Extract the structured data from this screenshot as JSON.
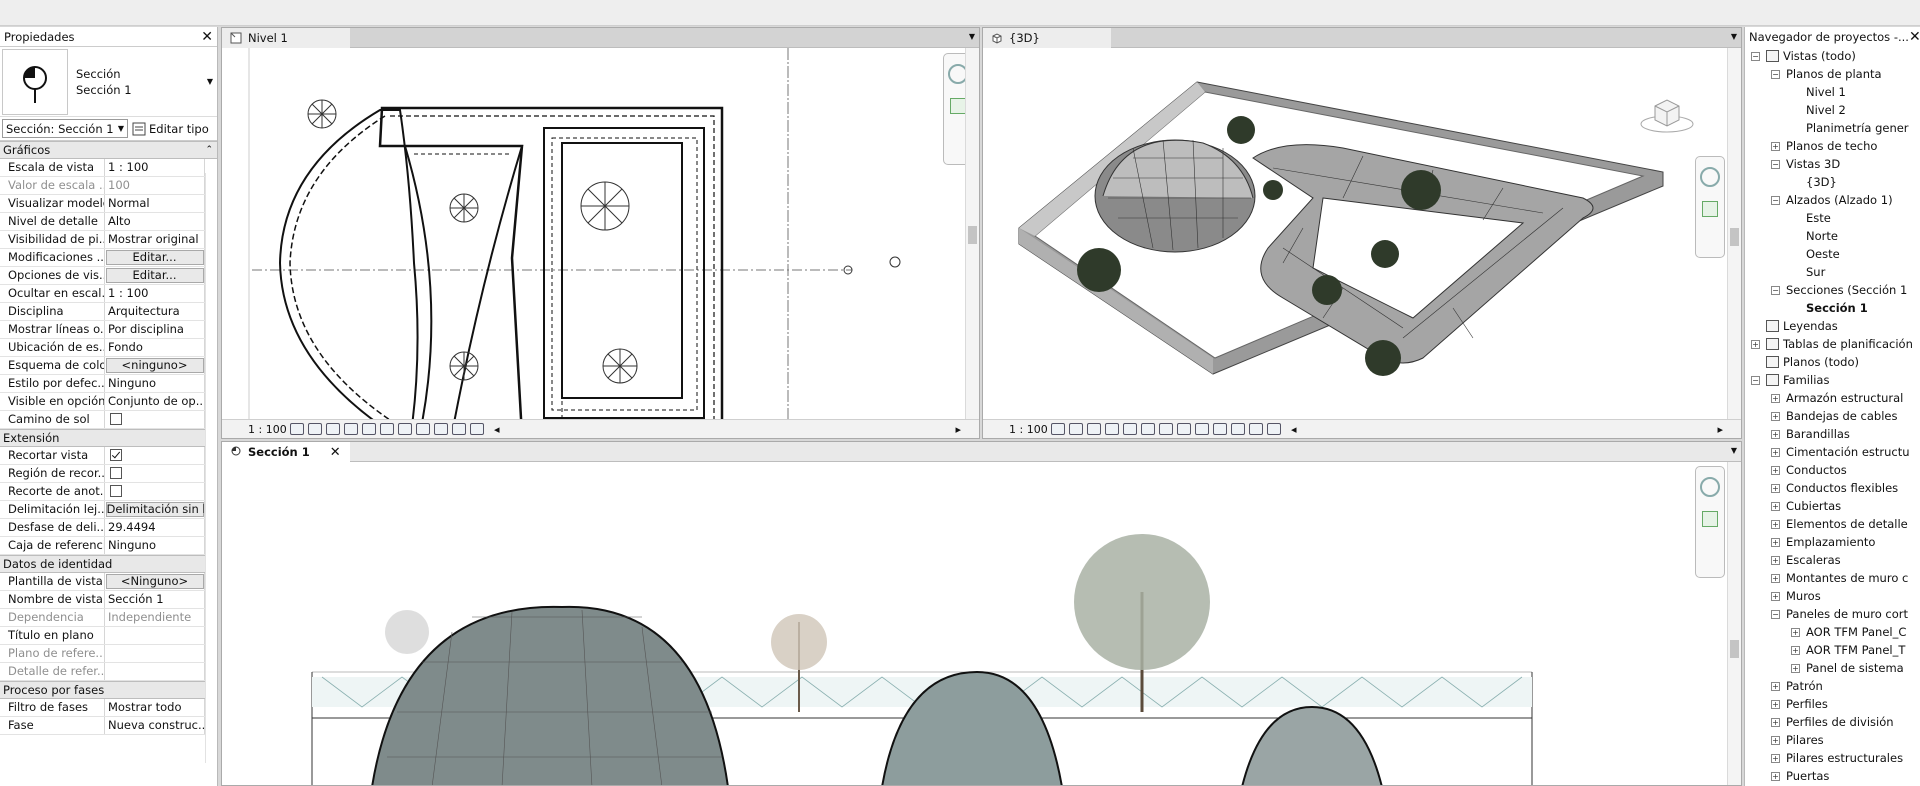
{
  "properties": {
    "title": "Propiedades",
    "close": "✕",
    "type_name": "Sección",
    "type_sub": "Sección 1",
    "selector": "Sección: Sección 1",
    "edit_type": "Editar tipo",
    "groups": [
      {
        "label": "Gráficos",
        "rows": [
          {
            "k": "Escala de vista",
            "v": "1 : 100"
          },
          {
            "k": "Valor de escala ...",
            "v": "100",
            "dim": true
          },
          {
            "k": "Visualizar modelo",
            "v": "Normal"
          },
          {
            "k": "Nivel de detalle",
            "v": "Alto"
          },
          {
            "k": "Visibilidad de pi...",
            "v": "Mostrar original"
          },
          {
            "k": "Modificaciones ...",
            "btn": "Editar..."
          },
          {
            "k": "Opciones de vis...",
            "btn": "Editar..."
          },
          {
            "k": "Ocultar en escal...",
            "v": "1 : 100"
          },
          {
            "k": "Disciplina",
            "v": "Arquitectura"
          },
          {
            "k": "Mostrar líneas o...",
            "v": "Por disciplina"
          },
          {
            "k": "Ubicación de es...",
            "v": "Fondo"
          },
          {
            "k": "Esquema de color",
            "btn": "<ninguno>"
          },
          {
            "k": "Estilo por defec...",
            "v": "Ninguno"
          },
          {
            "k": "Visible en opción",
            "v": "Conjunto de op..."
          },
          {
            "k": "Camino de sol",
            "check": false
          }
        ]
      },
      {
        "label": "Extensión",
        "rows": [
          {
            "k": "Recortar vista",
            "check": true
          },
          {
            "k": "Región de recor...",
            "check": false
          },
          {
            "k": "Recorte de anot...",
            "check": false
          },
          {
            "k": "Delimitación lej...",
            "btn": "Delimitación sin lí"
          },
          {
            "k": "Desfase de deli...",
            "v": "29.4494"
          },
          {
            "k": "Caja de referencia",
            "v": "Ninguno"
          }
        ]
      },
      {
        "label": "Datos de identidad",
        "rows": [
          {
            "k": "Plantilla de vista",
            "btn": "<Ninguno>"
          },
          {
            "k": "Nombre de vista",
            "v": "Sección 1"
          },
          {
            "k": "Dependencia",
            "v": "Independiente",
            "dim": true
          },
          {
            "k": "Título en plano",
            "v": ""
          },
          {
            "k": "Plano de refere...",
            "v": "",
            "dim": true
          },
          {
            "k": "Detalle de refer...",
            "v": "",
            "dim": true
          }
        ]
      },
      {
        "label": "Proceso por fases",
        "rows": [
          {
            "k": "Filtro de fases",
            "v": "Mostrar todo"
          },
          {
            "k": "Fase",
            "v": "Nueva construc..."
          }
        ]
      }
    ]
  },
  "views": {
    "nivel1": {
      "tab": "Nivel 1",
      "scale": "1 : 100"
    },
    "view3d": {
      "tab": "{3D}",
      "scale": "1 : 100"
    },
    "section": {
      "tab": "Sección 1",
      "close": "✕"
    }
  },
  "browser": {
    "title": "Navegador de proyectos -...",
    "close": "✕",
    "items": [
      {
        "d": 0,
        "t": "−",
        "icon": true,
        "label": "Vistas (todo)"
      },
      {
        "d": 1,
        "t": "−",
        "label": "Planos de planta"
      },
      {
        "d": 2,
        "label": "Nivel 1"
      },
      {
        "d": 2,
        "label": "Nivel 2"
      },
      {
        "d": 2,
        "label": "Planimetría gener"
      },
      {
        "d": 1,
        "t": "+",
        "label": "Planos de techo"
      },
      {
        "d": 1,
        "t": "−",
        "label": "Vistas 3D"
      },
      {
        "d": 2,
        "label": "{3D}"
      },
      {
        "d": 1,
        "t": "−",
        "label": "Alzados (Alzado 1)"
      },
      {
        "d": 2,
        "label": "Este"
      },
      {
        "d": 2,
        "label": "Norte"
      },
      {
        "d": 2,
        "label": "Oeste"
      },
      {
        "d": 2,
        "label": "Sur"
      },
      {
        "d": 1,
        "t": "−",
        "label": "Secciones (Sección 1"
      },
      {
        "d": 2,
        "label": "Sección 1",
        "bold": true
      },
      {
        "d": 0,
        "icon": true,
        "label": "Leyendas"
      },
      {
        "d": 0,
        "t": "+",
        "icon": true,
        "label": "Tablas de planificación"
      },
      {
        "d": 0,
        "icon": true,
        "label": "Planos (todo)"
      },
      {
        "d": 0,
        "t": "−",
        "icon": true,
        "label": "Familias"
      },
      {
        "d": 1,
        "t": "+",
        "label": "Armazón estructural"
      },
      {
        "d": 1,
        "t": "+",
        "label": "Bandejas de cables"
      },
      {
        "d": 1,
        "t": "+",
        "label": "Barandillas"
      },
      {
        "d": 1,
        "t": "+",
        "label": "Cimentación estructu"
      },
      {
        "d": 1,
        "t": "+",
        "label": "Conductos"
      },
      {
        "d": 1,
        "t": "+",
        "label": "Conductos flexibles"
      },
      {
        "d": 1,
        "t": "+",
        "label": "Cubiertas"
      },
      {
        "d": 1,
        "t": "+",
        "label": "Elementos de detalle"
      },
      {
        "d": 1,
        "t": "+",
        "label": "Emplazamiento"
      },
      {
        "d": 1,
        "t": "+",
        "label": "Escaleras"
      },
      {
        "d": 1,
        "t": "+",
        "label": "Montantes de muro c"
      },
      {
        "d": 1,
        "t": "+",
        "label": "Muros"
      },
      {
        "d": 1,
        "t": "−",
        "label": "Paneles de muro cort"
      },
      {
        "d": 2,
        "t": "+",
        "label": "AOR TFM Panel_C"
      },
      {
        "d": 2,
        "t": "+",
        "label": "AOR TFM Panel_T"
      },
      {
        "d": 2,
        "t": "+",
        "label": "Panel de sistema"
      },
      {
        "d": 1,
        "t": "+",
        "label": "Patrón"
      },
      {
        "d": 1,
        "t": "+",
        "label": "Perfiles"
      },
      {
        "d": 1,
        "t": "+",
        "label": "Perfiles de división"
      },
      {
        "d": 1,
        "t": "+",
        "label": "Pilares"
      },
      {
        "d": 1,
        "t": "+",
        "label": "Pilares estructurales"
      },
      {
        "d": 1,
        "t": "+",
        "label": "Puertas"
      }
    ]
  }
}
